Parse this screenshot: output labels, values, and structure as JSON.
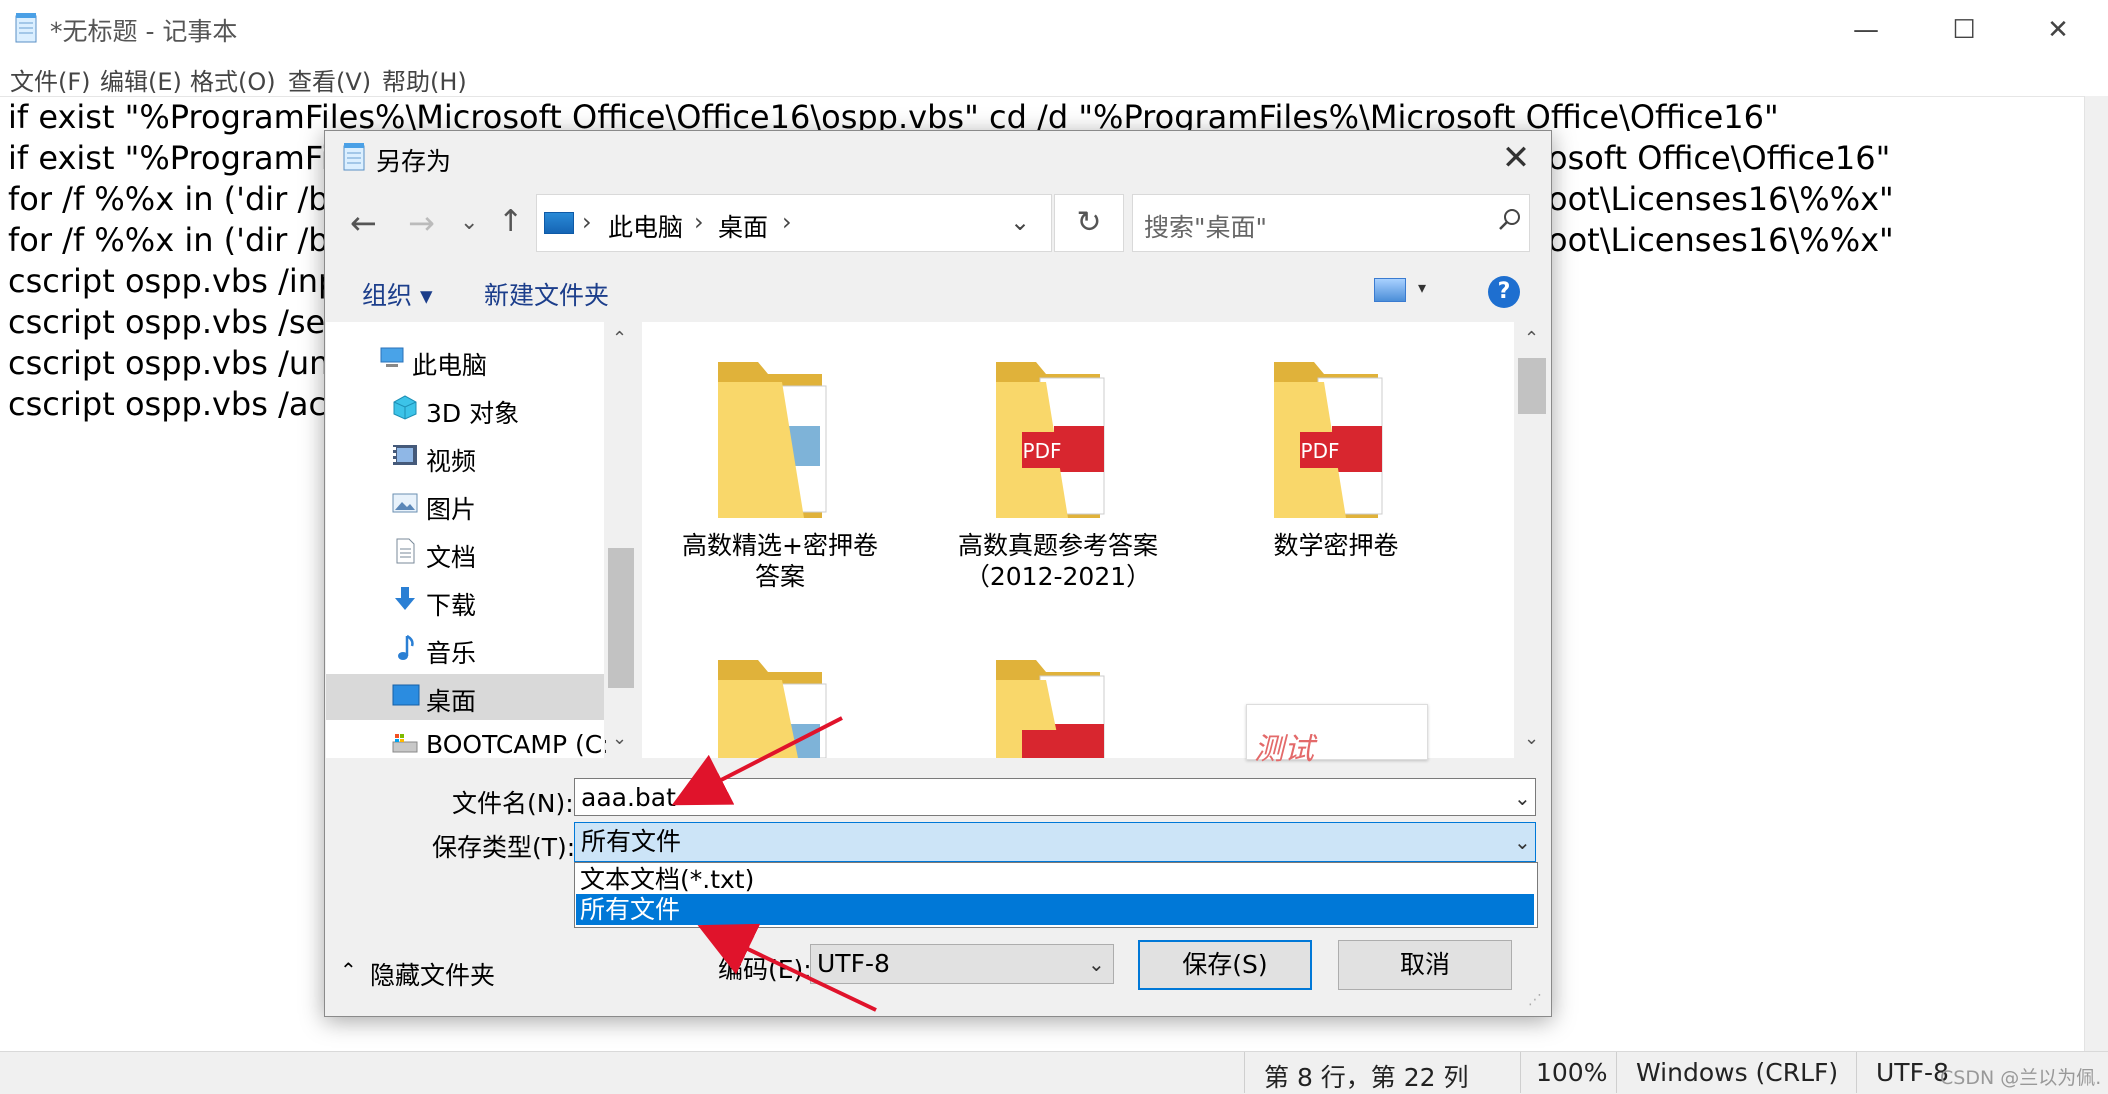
{
  "notepad": {
    "title": "*无标题 - 记事本",
    "window_controls": {
      "minimize": "—",
      "maximize": "☐",
      "close": "✕"
    },
    "menu": [
      "文件(F)",
      "编辑(E)",
      "格式(O)",
      "查看(V)",
      "帮助(H)"
    ],
    "lines": [
      "if exist \"%ProgramFiles%\\Microsoft Office\\Office16\\ospp.vbs\" cd /d \"%ProgramFiles%\\Microsoft Office\\Office16\"",
      "if exist \"%ProgramFil",
      "for /f %%x in ('dir /b",
      "for /f %%x in ('dir /b",
      "cscript ospp.vbs /inp",
      "cscript ospp.vbs /setl",
      "cscript ospp.vbs /unp",
      "cscript ospp.vbs /act"
    ],
    "lines_right": [
      "osoft Office\\Office16\"",
      "oot\\Licenses16\\%%x\"",
      "oot\\Licenses16\\%%x\""
    ],
    "status": {
      "position": "第 8 行，第 22 列",
      "zoom": "100%",
      "line_ending": "Windows (CRLF)",
      "encoding": "UTF-8"
    },
    "watermark": "CSDN @兰以为佩."
  },
  "dialog": {
    "title": "另存为",
    "close": "✕",
    "nav": {
      "back": "←",
      "forward": "→",
      "recent": "⌄",
      "up": "↑",
      "refresh": "↻"
    },
    "breadcrumb": [
      "此电脑",
      "桌面"
    ],
    "search_placeholder": "搜索\"桌面\"",
    "toolbar": {
      "organize": "组织 ▾",
      "new_folder": "新建文件夹",
      "help": "?"
    },
    "nav_items": [
      "此电脑",
      "3D 对象",
      "视频",
      "图片",
      "文档",
      "下载",
      "音乐",
      "桌面",
      "BOOTCAMP (C:"
    ],
    "folders": [
      {
        "label": "高数精选+密押卷答案",
        "type": "folder"
      },
      {
        "label": "高数真题参考答案（2012-2021）",
        "type": "pdf-folder"
      },
      {
        "label": "数学密押卷",
        "type": "pdf-folder"
      },
      {
        "label": "",
        "type": "folder"
      },
      {
        "label": "",
        "type": "pdf-folder"
      },
      {
        "label": "",
        "type": "image"
      }
    ],
    "thumbnail_text": "测试",
    "filename_label": "文件名(N):",
    "filename_value": "aaa.bat",
    "filetype_label": "保存类型(T):",
    "filetype_value": "所有文件",
    "filetype_options": [
      "文本文档(*.txt)",
      "所有文件"
    ],
    "hide_folders": "隐藏文件夹",
    "encoding_label": "编码(E):",
    "encoding_value": "UTF-8",
    "save_button": "保存(S)",
    "cancel_button": "取消"
  },
  "colors": {
    "accent": "#0078d7",
    "arrow": "#e0132b",
    "folder": "#f5cb5c",
    "pdf_red": "#d8262f"
  }
}
